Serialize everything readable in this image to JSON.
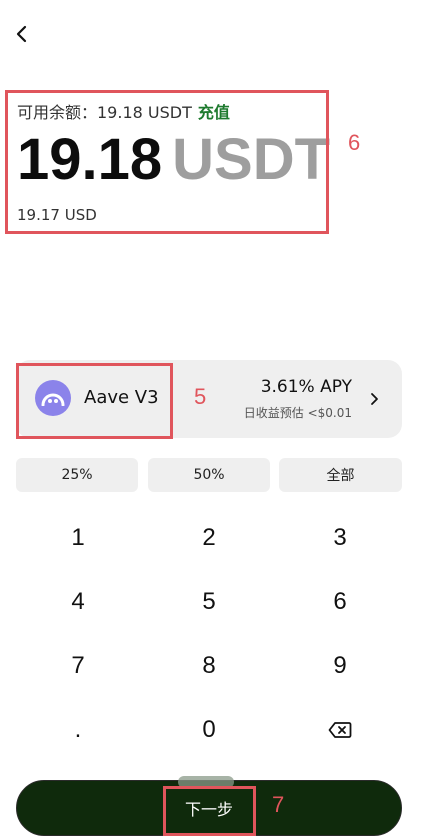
{
  "header": {
    "back_icon": "chevron-left-icon"
  },
  "balance": {
    "available_label": "可用余额：19.18 USDT",
    "recharge_label": "充值",
    "amount": "19.18",
    "unit": "USDT",
    "usd_value": "19.17 USD"
  },
  "protocol": {
    "name": "Aave V3",
    "apy": "3.61% APY",
    "daily_estimate": "日收益预估 <$0.01",
    "icon": "aave-ghost-icon",
    "avatar_color": "#8b83ea"
  },
  "percent_buttons": [
    "25%",
    "50%",
    "全部"
  ],
  "keypad": {
    "keys": [
      "1",
      "2",
      "3",
      "4",
      "5",
      "6",
      "7",
      "8",
      "9",
      ".",
      "0"
    ],
    "backspace_icon": "backspace-icon"
  },
  "actions": {
    "next_label": "下一步"
  },
  "annotations": {
    "balance": "6",
    "protocol": "5",
    "next": "7"
  },
  "colors": {
    "accent_green": "#1e7a2e",
    "button_dark": "#0f2a0c",
    "annotation_red": "#e0555c"
  }
}
